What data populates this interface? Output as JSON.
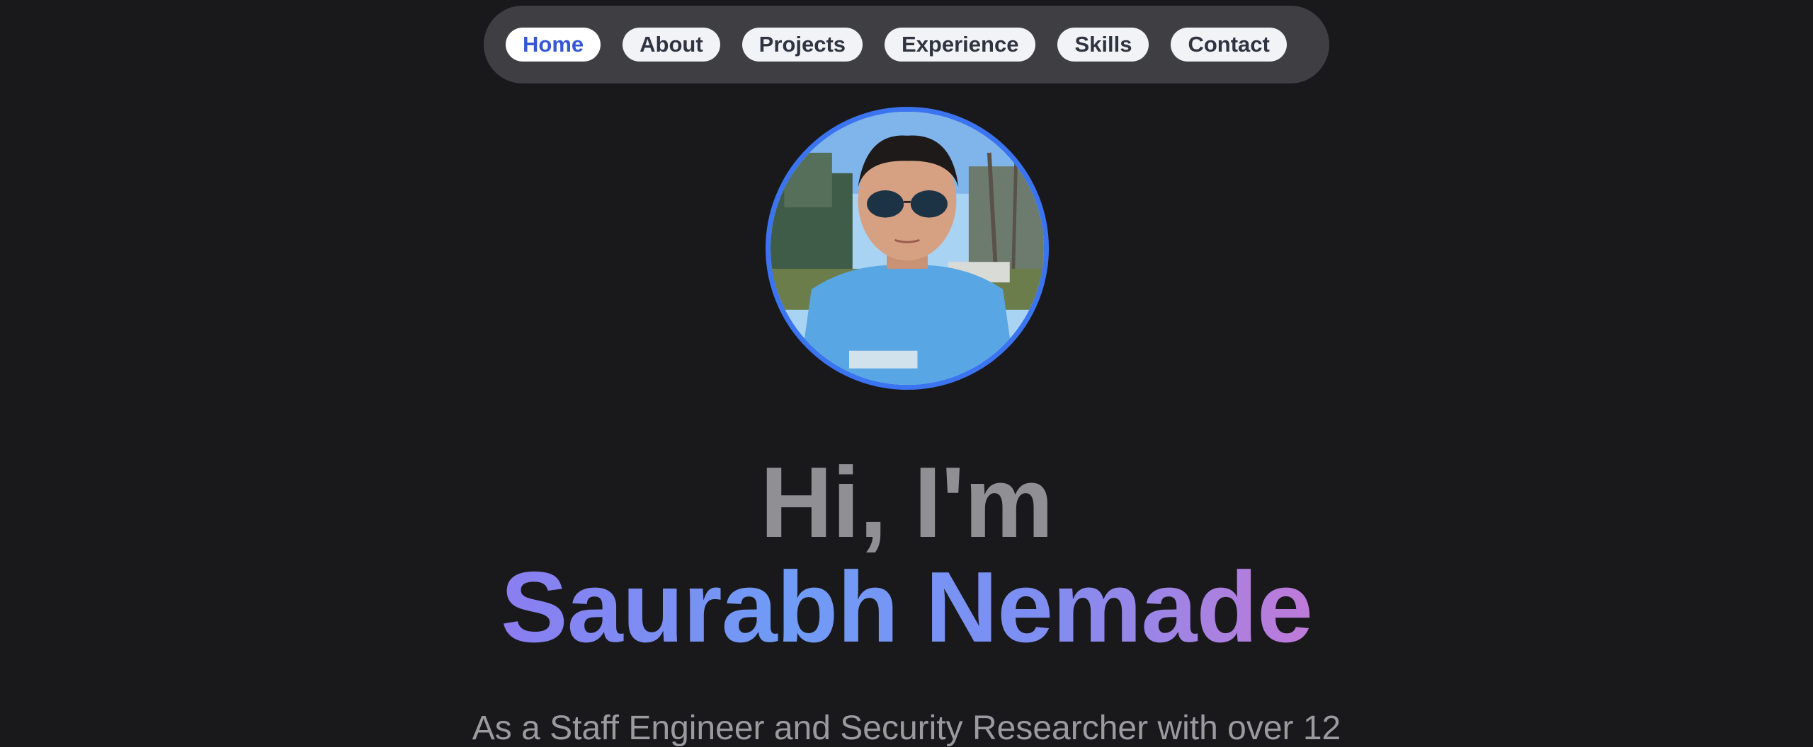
{
  "nav": {
    "items": [
      {
        "label": "Home",
        "active": true
      },
      {
        "label": "About",
        "active": false
      },
      {
        "label": "Projects",
        "active": false
      },
      {
        "label": "Experience",
        "active": false
      },
      {
        "label": "Skills",
        "active": false
      },
      {
        "label": "Contact",
        "active": false
      }
    ]
  },
  "hero": {
    "greeting": "Hi, I'm",
    "name": "Saurabh Nemade",
    "tagline": "As a Staff Engineer and Security Researcher with over 12"
  },
  "colors": {
    "background": "#19191b",
    "nav_bg": "#3f3f43",
    "accent": "#3b74f0",
    "active_nav_text": "#3557d6"
  }
}
